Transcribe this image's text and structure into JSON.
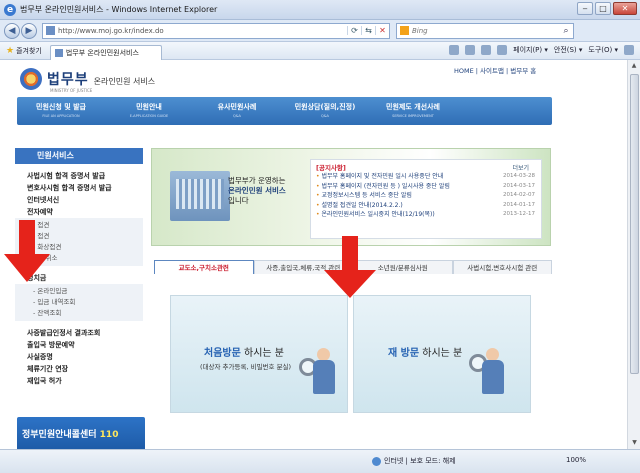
{
  "window": {
    "title": "법무부 온라인민원서비스 - Windows Internet Explorer",
    "buttons": [
      "‒",
      "□",
      "✕"
    ]
  },
  "address": {
    "url": "http://www.moj.go.kr/index.do",
    "search_placeholder": "Bing"
  },
  "commandbar": {
    "favorites_label": "즐겨찾기",
    "tab_title": "법무부 온라인민원서비스",
    "menus": [
      "페이지(P) ▾",
      "안전(S) ▾",
      "도구(O) ▾"
    ]
  },
  "site": {
    "brand": "법무부",
    "brand_sub": "MINISTRY OF JUSTICE",
    "service": "온라인민원 서비스",
    "toplinks": "HOME | 사이트맵 | 법무부 홈"
  },
  "gnb": [
    {
      "label": "민원신청 및 발급",
      "en": "FILE AN APPLICATION"
    },
    {
      "label": "민원안내",
      "en": "E-APPLICATION GUIDE"
    },
    {
      "label": "유사민원사례",
      "en": "Q&A"
    },
    {
      "label": "민원상담(질의,진정)",
      "en": "Q&A"
    },
    {
      "label": "민원제도 개선사례",
      "en": "SERVICE IMPROVEMENT"
    }
  ],
  "lnb": {
    "title": "민원서비스",
    "group1": [
      "사법시험 합격 증명서 발급",
      "변호사시험 합격 증명서 발급",
      "인터넷서신",
      "전자예약"
    ],
    "sub1": [
      "- 접견",
      "- 접견",
      "- 화상접견",
      "- 세/취소"
    ],
    "group2": [
      "영치금"
    ],
    "sub2": [
      "- 온라인입금",
      "- 입금 내역조회",
      "- 잔액조회"
    ],
    "group3": [
      "사증발급인정서 결과조회",
      "출입국 방문예약",
      "사실증명",
      "체류기간 연장",
      "재입국 허가"
    ],
    "banner_text": "정부민원안내콜센터",
    "banner_num": "110"
  },
  "hero": {
    "tagline_1": "법무부가 운영하는",
    "tagline_2": "온라인민원 서비스",
    "tagline_3": "입니다"
  },
  "notice": {
    "heading": "[공지사항]",
    "more": "더보기",
    "items": [
      {
        "title": "법무부 홈페이지 및 전자민원 일시 사용중단 안내",
        "date": "2014-03-28"
      },
      {
        "title": "법무부 홈페이지 (전자민원 등 ) 일시사용 중단 알림",
        "date": "2014-03-17"
      },
      {
        "title": "교정정보시스템 등 서비스 중단 알림",
        "date": "2014-02-07"
      },
      {
        "title": "설명절 접견일 안내(2014.2.2.)",
        "date": "2014-01-17"
      },
      {
        "title": "온라인민원서비스 일시중지 안내(12/19(목))",
        "date": "2013-12-17"
      }
    ]
  },
  "tabs": [
    "교도소,구치소관련",
    "사증,출입국,체류,국적 관련",
    "소년원/분류심사원",
    "사법시험,변호사시험 관련"
  ],
  "cards": {
    "first_strong": "처음방문",
    "first_rest": " 하시는 분",
    "first_sub": "(대상자 추가등록, 비밀번호 분실)",
    "second_strong": "재 방문",
    "second_rest": " 하시는 분"
  },
  "statusbar": {
    "zone": "인터넷 | 보호 모드: 해제",
    "zoom": "100%"
  },
  "colors": {
    "accent_red": "#e5231b",
    "nav_blue": "#2f6db5"
  }
}
